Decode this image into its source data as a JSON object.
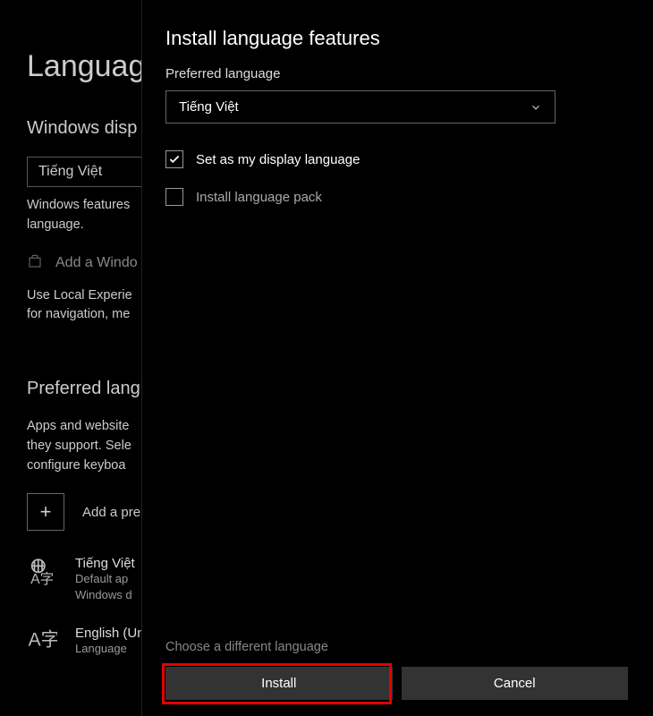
{
  "background": {
    "heading": "Language",
    "displaySection": "Windows disp",
    "dropdownValue": "Tiếng Việt",
    "featuresText1": "Windows features",
    "featuresText2": "language.",
    "addWindows": "Add a Windo",
    "localExp1": "Use Local Experie",
    "localExp2": "for navigation, me",
    "prefSection": "Preferred lang",
    "appsText1": "Apps and website",
    "appsText2": "they support. Sele",
    "appsText3": "configure keyboa",
    "addPref": "Add a pre",
    "lang1": {
      "name": "Tiếng Việt",
      "sub1": "Default ap",
      "sub2": "Windows d"
    },
    "lang2": {
      "name": "English (Un",
      "sub1": "Language"
    }
  },
  "modal": {
    "title": "Install language features",
    "label": "Preferred language",
    "dropdownValue": "Tiếng Việt",
    "checkbox1": "Set as my display language",
    "checkbox2": "Install language pack",
    "diffLang": "Choose a different language",
    "install": "Install",
    "cancel": "Cancel"
  }
}
